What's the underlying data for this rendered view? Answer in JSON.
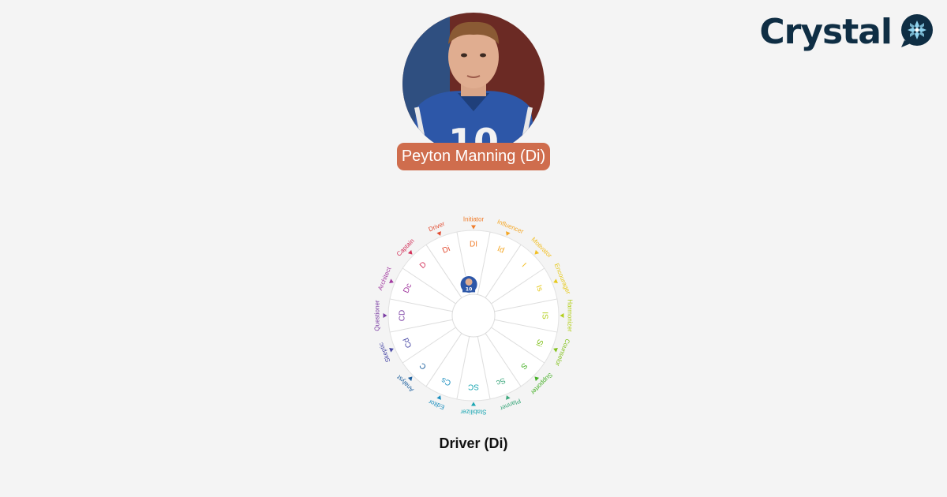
{
  "brand": {
    "name": "Crystal",
    "logo_icon": "crystal-gem-icon",
    "color": "#0f2e44"
  },
  "profile": {
    "name_label": "Peyton Manning (Di)",
    "pill_color": "#cf6d4d",
    "photo": "person-photo"
  },
  "wheel": {
    "segments": [
      {
        "code": "DI",
        "name": "Initiator",
        "color": "#f07c2a"
      },
      {
        "code": "Id",
        "name": "Influencer",
        "color": "#f5a623"
      },
      {
        "code": "I",
        "name": "Motivator",
        "color": "#f2bf24"
      },
      {
        "code": "Is",
        "name": "Encourager",
        "color": "#e6c91b"
      },
      {
        "code": "IS",
        "name": "Harmonizer",
        "color": "#b3cf1d"
      },
      {
        "code": "Si",
        "name": "Counselor",
        "color": "#82c11d"
      },
      {
        "code": "S",
        "name": "Supporter",
        "color": "#45b026"
      },
      {
        "code": "Sc",
        "name": "Planner",
        "color": "#3aa77b"
      },
      {
        "code": "SC",
        "name": "Stabilizer",
        "color": "#1aa6b2"
      },
      {
        "code": "Cs",
        "name": "Editor",
        "color": "#1c8fbf"
      },
      {
        "code": "C",
        "name": "Analyst",
        "color": "#1c5f9e"
      },
      {
        "code": "Cd",
        "name": "Skeptic",
        "color": "#4a4aa6"
      },
      {
        "code": "CD",
        "name": "Questioner",
        "color": "#7a3da3"
      },
      {
        "code": "Dc",
        "name": "Architect",
        "color": "#a23aa0"
      },
      {
        "code": "D",
        "name": "Captain",
        "color": "#d3325a"
      },
      {
        "code": "Di",
        "name": "Driver",
        "color": "#e24b30"
      }
    ],
    "current_code": "Di"
  },
  "result_label": "Driver (Di)"
}
